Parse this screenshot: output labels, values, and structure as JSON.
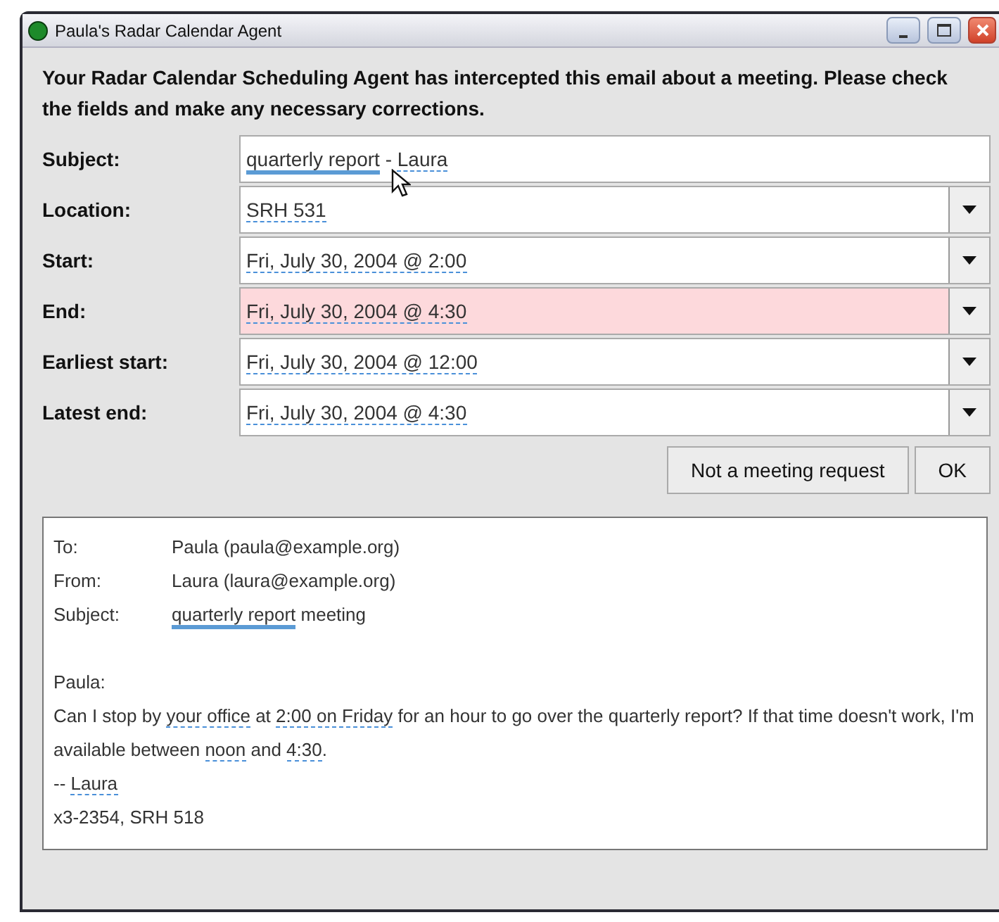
{
  "window": {
    "title": "Paula's Radar Calendar Agent"
  },
  "intro": "Your Radar Calendar Scheduling Agent has intercepted this email about a meeting. Please check the fields and make any necessary corrections.",
  "fields": [
    {
      "label": "Subject:",
      "kind": "text",
      "flagged": false,
      "value": [
        {
          "text": "quarterly report",
          "kind": "highlight"
        },
        {
          "text": " - ",
          "kind": "plain"
        },
        {
          "text": "Laura",
          "kind": "entity"
        }
      ]
    },
    {
      "label": "Location:",
      "kind": "dropdown",
      "flagged": false,
      "value": [
        {
          "text": "SRH 531",
          "kind": "entity"
        }
      ]
    },
    {
      "label": "Start:",
      "kind": "dropdown",
      "flagged": false,
      "value": [
        {
          "text": "Fri, July 30, 2004 @ 2:00",
          "kind": "entity"
        }
      ]
    },
    {
      "label": "End:",
      "kind": "dropdown",
      "flagged": true,
      "value": [
        {
          "text": "Fri, July 30, 2004 @ 4:30",
          "kind": "entity"
        }
      ]
    },
    {
      "label": "Earliest start:",
      "kind": "dropdown",
      "flagged": false,
      "value": [
        {
          "text": "Fri, July 30, 2004 @ 12:00",
          "kind": "entity"
        }
      ]
    },
    {
      "label": "Latest end:",
      "kind": "dropdown",
      "flagged": false,
      "value": [
        {
          "text": "Fri, July 30, 2004 @ 4:30",
          "kind": "entity"
        }
      ]
    }
  ],
  "buttons": [
    "Not a meeting request",
    "OK"
  ],
  "email": {
    "headers": [
      {
        "label": "To:",
        "value": [
          {
            "text": "Paula (paula@example.org)",
            "kind": "plain"
          }
        ]
      },
      {
        "label": "From:",
        "value": [
          {
            "text": "Laura (laura@example.org)",
            "kind": "plain"
          }
        ]
      },
      {
        "label": "Subject:",
        "value": [
          {
            "text": "quarterly report",
            "kind": "highlight"
          },
          {
            "text": " meeting",
            "kind": "plain"
          }
        ]
      }
    ],
    "body": [
      [
        {
          "text": "Paula:",
          "kind": "plain"
        }
      ],
      [
        {
          "text": "Can I stop by ",
          "kind": "plain"
        },
        {
          "text": "your office",
          "kind": "entity"
        },
        {
          "text": " at ",
          "kind": "plain"
        },
        {
          "text": "2:00 on Friday",
          "kind": "entity"
        },
        {
          "text": " for an hour to go over the quarterly report? If that time doesn't work, I'm available between ",
          "kind": "plain"
        },
        {
          "text": "noon",
          "kind": "entity"
        },
        {
          "text": " and ",
          "kind": "plain"
        },
        {
          "text": "4:30",
          "kind": "entity"
        },
        {
          "text": ".",
          "kind": "plain"
        }
      ],
      [
        {
          "text": "-- ",
          "kind": "plain"
        },
        {
          "text": "Laura",
          "kind": "entity"
        }
      ],
      [
        {
          "text": "x3-2354, SRH 518",
          "kind": "plain"
        }
      ]
    ]
  }
}
